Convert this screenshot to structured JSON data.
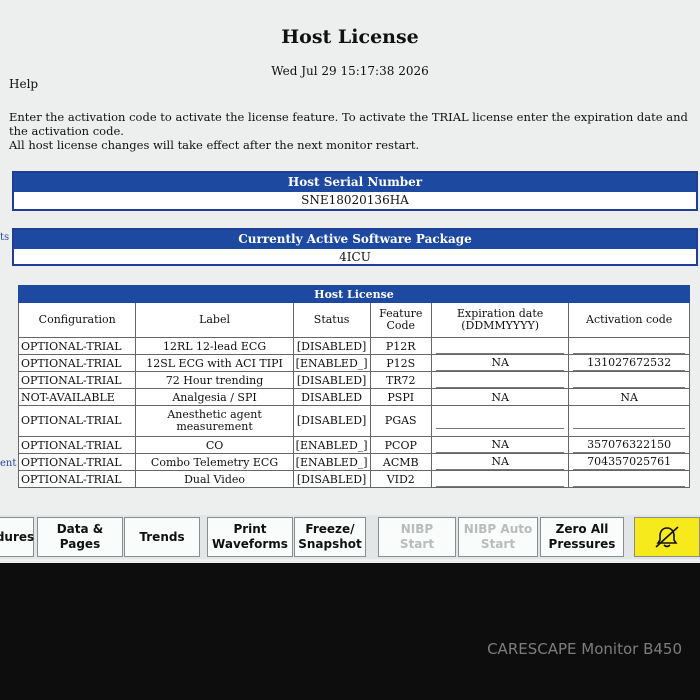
{
  "header": {
    "title": "Host License",
    "datetime": "Wed Jul 29 15:17:38 2026",
    "help": "Help",
    "instructions_line1": "Enter the activation code to activate the license feature. To activate the TRIAL license enter the expiration date and",
    "instructions_line2": "the activation code.",
    "instructions_line3": "All host license changes will take effect after the next monitor restart."
  },
  "serial": {
    "heading": "Host Serial Number",
    "value": "SNE18020136HA"
  },
  "package": {
    "heading": "Currently Active Software Package",
    "value": "4ICU",
    "edge_label": "ts"
  },
  "license_table": {
    "title": "Host License",
    "edge_label": "ent",
    "columns": [
      "Configuration",
      "Label",
      "Status",
      "Feature Code",
      "Expiration date (DDMMYYYY)",
      "Activation code"
    ],
    "rows": [
      {
        "config": "OPTIONAL-TRIAL",
        "label": "12RL 12-lead ECG",
        "status": "[DISABLED]",
        "code": "P12R",
        "expiration": "",
        "activation": ""
      },
      {
        "config": "OPTIONAL-TRIAL",
        "label": "12SL ECG with ACI TIPI",
        "status": "[ENABLED_]",
        "code": "P12S",
        "expiration": "NA",
        "activation": "131027672532"
      },
      {
        "config": "OPTIONAL-TRIAL",
        "label": "72 Hour trending",
        "status": "[DISABLED]",
        "code": "TR72",
        "expiration": "",
        "activation": ""
      },
      {
        "config": "NOT-AVAILABLE",
        "label": "Analgesia / SPI",
        "status": "DISABLED",
        "code": "PSPI",
        "expiration": "NA",
        "activation": "NA"
      },
      {
        "config": "OPTIONAL-TRIAL",
        "label": "Anesthetic agent measurement",
        "status": "[DISABLED]",
        "code": "PGAS",
        "expiration": "",
        "activation": ""
      },
      {
        "config": "OPTIONAL-TRIAL",
        "label": "CO",
        "status": "[ENABLED_]",
        "code": "PCOP",
        "expiration": "NA",
        "activation": "357076322150"
      },
      {
        "config": "OPTIONAL-TRIAL",
        "label": "Combo Telemetry ECG",
        "status": "[ENABLED_]",
        "code": "ACMB",
        "expiration": "NA",
        "activation": "704357025761"
      },
      {
        "config": "OPTIONAL-TRIAL",
        "label": "Dual Video",
        "status": "[DISABLED]",
        "code": "VID2",
        "expiration": "",
        "activation": ""
      }
    ]
  },
  "toolbar": {
    "procedures": "dures",
    "data_pages_1": "Data &",
    "data_pages_2": "Pages",
    "trends": "Trends",
    "print_1": "Print",
    "print_2": "Waveforms",
    "freeze_1": "Freeze/",
    "freeze_2": "Snapshot",
    "nibp_1": "NIBP",
    "nibp_2": "Start",
    "nibp_auto_1": "NIBP Auto",
    "nibp_auto_2": "Start",
    "zero_1": "Zero All",
    "zero_2": "Pressures",
    "alarm_icon": "alarm-silence-icon",
    "alarm_color": "#f6ea1c"
  },
  "device": {
    "brand": "CARESCAPE",
    "model": "Monitor B450"
  }
}
